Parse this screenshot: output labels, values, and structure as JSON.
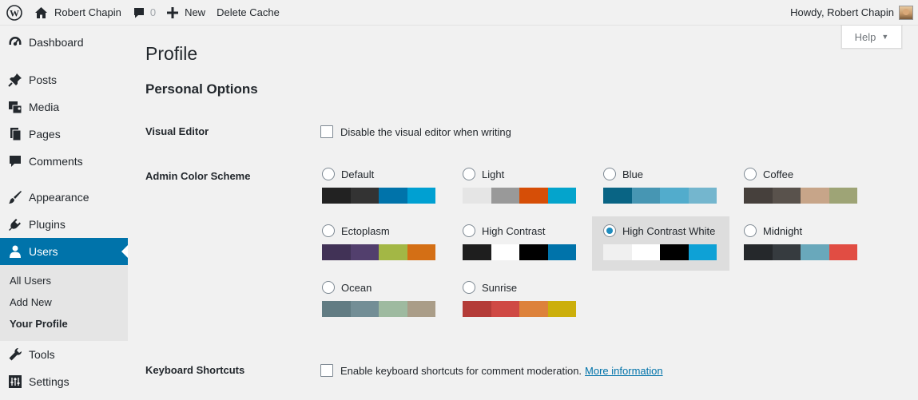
{
  "adminbar": {
    "site_name": "Robert Chapin",
    "comments_count": "0",
    "new_label": "New",
    "delete_cache_label": "Delete Cache",
    "howdy": "Howdy, Robert Chapin"
  },
  "sidebar": {
    "items": [
      {
        "label": "Dashboard",
        "icon": "dashboard-icon"
      },
      {
        "label": "Posts",
        "icon": "pin-icon"
      },
      {
        "label": "Media",
        "icon": "media-icon"
      },
      {
        "label": "Pages",
        "icon": "pages-icon"
      },
      {
        "label": "Comments",
        "icon": "comment-icon"
      },
      {
        "label": "Appearance",
        "icon": "brush-icon"
      },
      {
        "label": "Plugins",
        "icon": "plug-icon"
      },
      {
        "label": "Users",
        "icon": "user-icon"
      },
      {
        "label": "Tools",
        "icon": "wrench-icon"
      },
      {
        "label": "Settings",
        "icon": "settings-icon"
      }
    ],
    "users_submenu": [
      "All Users",
      "Add New",
      "Your Profile"
    ]
  },
  "help_label": "Help",
  "page_title": "Profile",
  "section_title": "Personal Options",
  "visual_editor": {
    "label": "Visual Editor",
    "checkbox_text": "Disable the visual editor when writing",
    "checked": false
  },
  "color_scheme": {
    "label": "Admin Color Scheme",
    "selected": "High Contrast White",
    "schemes": [
      {
        "name": "Default",
        "colors": [
          "#222222",
          "#333333",
          "#0073aa",
          "#00a0d2"
        ]
      },
      {
        "name": "Light",
        "colors": [
          "#e5e5e5",
          "#999999",
          "#d64e07",
          "#04a4cc"
        ]
      },
      {
        "name": "Blue",
        "colors": [
          "#096484",
          "#4796b3",
          "#52accc",
          "#74b6ce"
        ]
      },
      {
        "name": "Coffee",
        "colors": [
          "#46403c",
          "#59524c",
          "#c7a589",
          "#9ea476"
        ]
      },
      {
        "name": "Ectoplasm",
        "colors": [
          "#413256",
          "#523f6d",
          "#a3b745",
          "#d46f15"
        ]
      },
      {
        "name": "High Contrast",
        "colors": [
          "#1e1e1e",
          "#ffffff",
          "#000000",
          "#0073aa"
        ]
      },
      {
        "name": "High Contrast White",
        "colors": [
          "#f0f0f0",
          "#ffffff",
          "#000000",
          "#0ea1d6"
        ]
      },
      {
        "name": "Midnight",
        "colors": [
          "#25282b",
          "#363b3f",
          "#69a8bb",
          "#e14d43"
        ]
      },
      {
        "name": "Ocean",
        "colors": [
          "#627c83",
          "#738e96",
          "#9ebaa0",
          "#aa9d88"
        ]
      },
      {
        "name": "Sunrise",
        "colors": [
          "#b43c38",
          "#cf4944",
          "#dd823b",
          "#ccaf0b"
        ]
      }
    ]
  },
  "keyboard_shortcuts": {
    "label": "Keyboard Shortcuts",
    "checkbox_text": "Enable keyboard shortcuts for comment moderation.",
    "link_text": "More information",
    "checked": false
  }
}
